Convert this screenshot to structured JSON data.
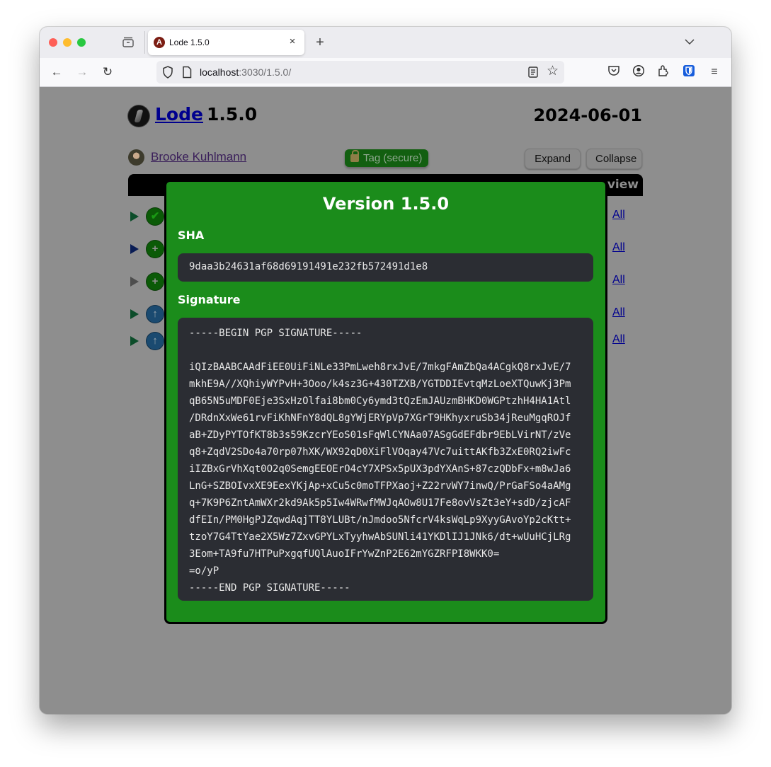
{
  "browser": {
    "tab_title": "Lode 1.5.0",
    "favicon_letter": "A",
    "url_host": "localhost",
    "url_rest": ":3030/1.5.0/",
    "icons": {
      "new_tab": "+",
      "close_tab": "×",
      "back": "←",
      "forward": "→",
      "reload": "↻",
      "tab_list": "⌄",
      "star": "☆",
      "menu": "≡"
    }
  },
  "page": {
    "project_name": "Lode",
    "project_version": "1.5.0",
    "release_date": "2024-06-01",
    "author": "Brooke Kuhlmann",
    "tag_badge": "Tag (secure)",
    "expand_label": "Expand",
    "collapse_label": "Collapse",
    "table_header_partial": "eview",
    "rows": [
      {
        "status": "check",
        "status_glyph": "✔",
        "link": "All"
      },
      {
        "status": "plus",
        "status_glyph": "+",
        "link": "All"
      },
      {
        "status": "plus",
        "status_glyph": "+",
        "link": "All"
      },
      {
        "status": "up",
        "status_glyph": "↑",
        "link": "All"
      },
      {
        "status": "up",
        "status_glyph": "↑",
        "link": "All"
      }
    ]
  },
  "modal": {
    "title": "Version 1.5.0",
    "sha_label": "SHA",
    "sha": "9daa3b24631af68d69191491e232fb572491d1e8",
    "signature_label": "Signature",
    "signature": "-----BEGIN PGP SIGNATURE-----\n\niQIzBAABCAAdFiEE0UiFiNLe33PmLweh8rxJvE/7mkgFAmZbQa4ACgkQ8rxJvE/7\nmkhE9A//XQhiyWYPvH+3Ooo/k4sz3G+430TZXB/YGTDDIEvtqMzLoeXTQuwKj3Pm\nqB65N5uMDF0Eje3SxHzOlfai8bm0Cy6ymd3tQzEmJAUzmBHKD0WGPtzhH4HA1Atl\n/DRdnXxWe61rvFiKhNFnY8dQL8gYWjERYpVp7XGrT9HKhyxruSb34jReuMgqROJf\naB+ZDyPYTOfKT8b3s59KzcrYEoS01sFqWlCYNAa07ASgGdEFdbr9EbLVirNT/zVe\nq8+ZqdV2SDo4a70rp07hXK/WX92qD0XiFlVOqay47Vc7uittAKfb3ZxE0RQ2iwFc\niIZBxGrVhXqt0O2q0SemgEEOErO4cY7XPSx5pUX3pdYXAnS+87czQDbFx+m8wJa6\nLnG+SZBOIvxXE9EexYKjAp+xCu5c0moTFPXaoj+Z22rvWY7inwQ/PrGaFSo4aAMg\nq+7K9P6ZntAmWXr2kd9Ak5p5Iw4WRwfMWJqAOw8U17Fe8ovVsZt3eY+sdD/zjcAF\ndfEIn/PM0HgPJZqwdAqjTT8YLUBt/nJmdoo5NfcrV4ksWqLp9XyyGAvoYp2cKtt+\ntzoY7G4TtYae2X5Wz7ZxvGPYLxTyyhwAbSUNli41YKDlIJ1JNk6/dt+wUuHCjLRg\n3Eom+TA9fu7HTPuPxgqfUQlAuoIFrYwZnP2E62mYGZRFPI8WKK0=\n=o/yP\n-----END PGP SIGNATURE-----"
  }
}
